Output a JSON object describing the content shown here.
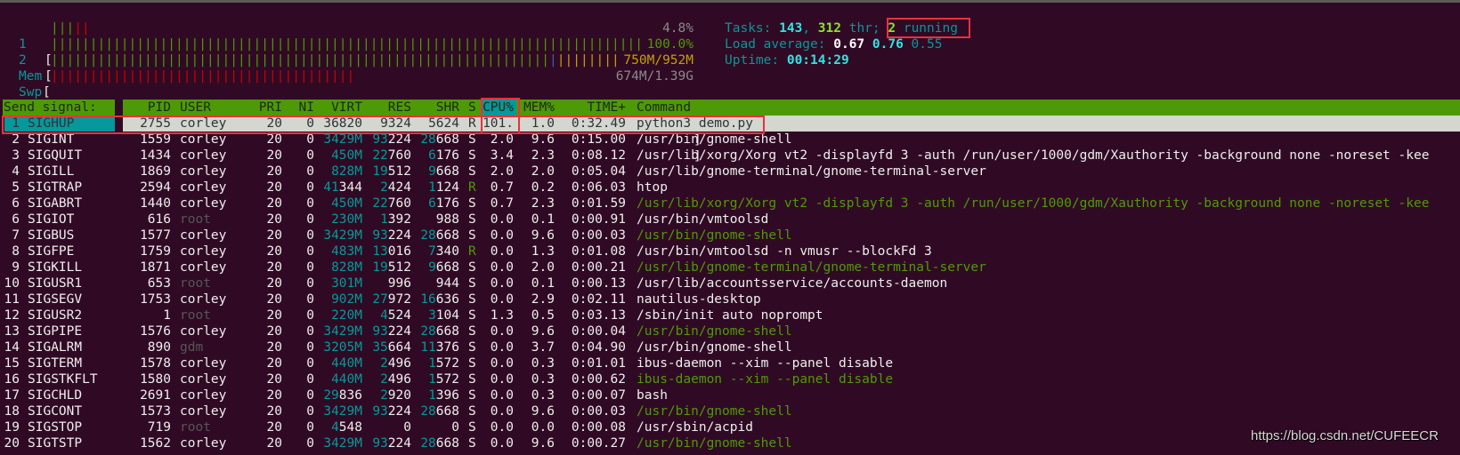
{
  "colors": {
    "background": "#300a24",
    "header_bar": "#4e9a06",
    "selection_signal": "#06989a",
    "selection_row": "#d3d7cf",
    "accent_teal": "#06989a",
    "thread_green": "#4e9a06",
    "dim_user": "#555753",
    "annotation_red": "#e8323c"
  },
  "meters": [
    {
      "label": "1",
      "value": "4.8%",
      "segments": [
        {
          "color": "#4e9a06",
          "percent": 3.7
        },
        {
          "color": "#cc0000",
          "percent": 2.4
        }
      ]
    },
    {
      "label": "2",
      "value": "100.0%",
      "segments": [
        {
          "color": "#4e9a06",
          "percent": 98.8
        },
        {
          "color": "#cc0000",
          "percent": 1.2
        }
      ]
    },
    {
      "label": "Mem",
      "value": "750M/952M",
      "segments": [
        {
          "color": "#4e9a06",
          "percent": 78
        },
        {
          "color": "#3465a4",
          "percent": 1.2
        },
        {
          "color": "#c4a000",
          "percent": 14.6
        }
      ]
    },
    {
      "label": "Swp",
      "value": "674M/1.39G",
      "segments": [
        {
          "color": "#cc0000",
          "percent": 47.6
        }
      ]
    }
  ],
  "info": {
    "tasks_label": "Tasks: ",
    "tasks": "143",
    "sep": ", ",
    "threads": "312",
    "thr_label": " thr; ",
    "running": "2",
    "running_label": " running",
    "load_label": "Load average: ",
    "load1": "0.67",
    "load5": "0.76",
    "load15": "0.55",
    "uptime_label": "Uptime: ",
    "uptime": "00:14:29"
  },
  "signal_panel": {
    "title": "Send signal:",
    "selected_index": 0
  },
  "columns": {
    "pid": "PID",
    "user": "USER",
    "pri": "PRI",
    "ni": "NI",
    "virt": "VIRT",
    "res": "RES",
    "shr": "SHR",
    "s": "S",
    "cpu": "CPU%",
    "mem": "MEM%",
    "time": "TIME+",
    "command": "Command",
    "sorted_by": "cpu"
  },
  "signals": [
    {
      "num": "1",
      "name": "SIGHUP"
    },
    {
      "num": "2",
      "name": "SIGINT"
    },
    {
      "num": "3",
      "name": "SIGQUIT"
    },
    {
      "num": "4",
      "name": "SIGILL"
    },
    {
      "num": "5",
      "name": "SIGTRAP"
    },
    {
      "num": "6",
      "name": "SIGABRT"
    },
    {
      "num": "6",
      "name": "SIGIOT"
    },
    {
      "num": "7",
      "name": "SIGBUS"
    },
    {
      "num": "8",
      "name": "SIGFPE"
    },
    {
      "num": "9",
      "name": "SIGKILL"
    },
    {
      "num": "10",
      "name": "SIGUSR1"
    },
    {
      "num": "11",
      "name": "SIGSEGV"
    },
    {
      "num": "12",
      "name": "SIGUSR2"
    },
    {
      "num": "13",
      "name": "SIGPIPE"
    },
    {
      "num": "14",
      "name": "SIGALRM"
    },
    {
      "num": "15",
      "name": "SIGTERM"
    },
    {
      "num": "16",
      "name": "SIGSTKFLT"
    },
    {
      "num": "17",
      "name": "SIGCHLD"
    },
    {
      "num": "18",
      "name": "SIGCONT"
    },
    {
      "num": "19",
      "name": "SIGSTOP"
    },
    {
      "num": "20",
      "name": "SIGTSTP"
    }
  ],
  "processes": [
    {
      "pid": "2755",
      "user": "corley",
      "pri": "20",
      "ni": "0",
      "virt": "36820",
      "res": "9324",
      "shr": "5624",
      "s": "R",
      "cpu": "101.",
      "mem": "1.0",
      "time": "0:32.49",
      "command": "python3 demo.py",
      "thread": false
    },
    {
      "pid": "1559",
      "user": "corley",
      "pri": "20",
      "ni": "0",
      "virt": "3429M",
      "res": "93224",
      "shr": "28668",
      "s": "S",
      "cpu": "2.0",
      "mem": "9.6",
      "time": "0:15.00",
      "command": "/usr/bin/gnome-shell",
      "thread": false
    },
    {
      "pid": "1434",
      "user": "corley",
      "pri": "20",
      "ni": "0",
      "virt": "450M",
      "res": "22760",
      "shr": "6176",
      "s": "S",
      "cpu": "3.4",
      "mem": "2.3",
      "time": "0:08.12",
      "command": "/usr/lib/xorg/Xorg vt2 -displayfd 3 -auth /run/user/1000/gdm/Xauthority -background none -noreset -kee",
      "thread": false
    },
    {
      "pid": "1869",
      "user": "corley",
      "pri": "20",
      "ni": "0",
      "virt": "828M",
      "res": "19512",
      "shr": "9668",
      "s": "S",
      "cpu": "2.0",
      "mem": "2.0",
      "time": "0:05.04",
      "command": "/usr/lib/gnome-terminal/gnome-terminal-server",
      "thread": false
    },
    {
      "pid": "2594",
      "user": "corley",
      "pri": "20",
      "ni": "0",
      "virt": "41344",
      "res": "2424",
      "shr": "1124",
      "s": "R",
      "cpu": "0.7",
      "mem": "0.2",
      "time": "0:06.03",
      "command": "htop",
      "thread": false
    },
    {
      "pid": "1440",
      "user": "corley",
      "pri": "20",
      "ni": "0",
      "virt": "450M",
      "res": "22760",
      "shr": "6176",
      "s": "S",
      "cpu": "0.7",
      "mem": "2.3",
      "time": "0:01.59",
      "command": "/usr/lib/xorg/Xorg vt2 -displayfd 3 -auth /run/user/1000/gdm/Xauthority -background none -noreset -kee",
      "thread": true
    },
    {
      "pid": "616",
      "user": "root",
      "pri": "20",
      "ni": "0",
      "virt": "230M",
      "res": "1392",
      "shr": "988",
      "s": "S",
      "cpu": "0.0",
      "mem": "0.1",
      "time": "0:00.91",
      "command": "/usr/bin/vmtoolsd",
      "thread": false
    },
    {
      "pid": "1577",
      "user": "corley",
      "pri": "20",
      "ni": "0",
      "virt": "3429M",
      "res": "93224",
      "shr": "28668",
      "s": "S",
      "cpu": "0.0",
      "mem": "9.6",
      "time": "0:00.03",
      "command": "/usr/bin/gnome-shell",
      "thread": true
    },
    {
      "pid": "1759",
      "user": "corley",
      "pri": "20",
      "ni": "0",
      "virt": "483M",
      "res": "13016",
      "shr": "7340",
      "s": "R",
      "cpu": "0.0",
      "mem": "1.3",
      "time": "0:01.08",
      "command": "/usr/bin/vmtoolsd -n vmusr --blockFd 3",
      "thread": false
    },
    {
      "pid": "1871",
      "user": "corley",
      "pri": "20",
      "ni": "0",
      "virt": "828M",
      "res": "19512",
      "shr": "9668",
      "s": "S",
      "cpu": "0.0",
      "mem": "2.0",
      "time": "0:00.21",
      "command": "/usr/lib/gnome-terminal/gnome-terminal-server",
      "thread": true
    },
    {
      "pid": "653",
      "user": "root",
      "pri": "20",
      "ni": "0",
      "virt": "301M",
      "res": "996",
      "shr": "944",
      "s": "S",
      "cpu": "0.0",
      "mem": "0.1",
      "time": "0:00.13",
      "command": "/usr/lib/accountsservice/accounts-daemon",
      "thread": false
    },
    {
      "pid": "1753",
      "user": "corley",
      "pri": "20",
      "ni": "0",
      "virt": "902M",
      "res": "27972",
      "shr": "16636",
      "s": "S",
      "cpu": "0.0",
      "mem": "2.9",
      "time": "0:02.11",
      "command": "nautilus-desktop",
      "thread": false
    },
    {
      "pid": "1",
      "user": "root",
      "pri": "20",
      "ni": "0",
      "virt": "220M",
      "res": "4524",
      "shr": "3104",
      "s": "S",
      "cpu": "1.3",
      "mem": "0.5",
      "time": "0:03.13",
      "command": "/sbin/init auto noprompt",
      "thread": false
    },
    {
      "pid": "1576",
      "user": "corley",
      "pri": "20",
      "ni": "0",
      "virt": "3429M",
      "res": "93224",
      "shr": "28668",
      "s": "S",
      "cpu": "0.0",
      "mem": "9.6",
      "time": "0:00.04",
      "command": "/usr/bin/gnome-shell",
      "thread": true
    },
    {
      "pid": "890",
      "user": "gdm",
      "pri": "20",
      "ni": "0",
      "virt": "3205M",
      "res": "35664",
      "shr": "11376",
      "s": "S",
      "cpu": "0.0",
      "mem": "3.7",
      "time": "0:04.90",
      "command": "/usr/bin/gnome-shell",
      "thread": false
    },
    {
      "pid": "1578",
      "user": "corley",
      "pri": "20",
      "ni": "0",
      "virt": "440M",
      "res": "2496",
      "shr": "1572",
      "s": "S",
      "cpu": "0.0",
      "mem": "0.3",
      "time": "0:01.01",
      "command": "ibus-daemon --xim --panel disable",
      "thread": false
    },
    {
      "pid": "1580",
      "user": "corley",
      "pri": "20",
      "ni": "0",
      "virt": "440M",
      "res": "2496",
      "shr": "1572",
      "s": "S",
      "cpu": "0.0",
      "mem": "0.3",
      "time": "0:00.62",
      "command": "ibus-daemon --xim --panel disable",
      "thread": true
    },
    {
      "pid": "2691",
      "user": "corley",
      "pri": "20",
      "ni": "0",
      "virt": "29836",
      "res": "2920",
      "shr": "1396",
      "s": "S",
      "cpu": "0.0",
      "mem": "0.3",
      "time": "0:00.07",
      "command": "bash",
      "thread": false
    },
    {
      "pid": "1573",
      "user": "corley",
      "pri": "20",
      "ni": "0",
      "virt": "3429M",
      "res": "93224",
      "shr": "28668",
      "s": "S",
      "cpu": "0.0",
      "mem": "9.6",
      "time": "0:00.03",
      "command": "/usr/bin/gnome-shell",
      "thread": true
    },
    {
      "pid": "719",
      "user": "root",
      "pri": "20",
      "ni": "0",
      "virt": "4548",
      "res": "0",
      "shr": "0",
      "s": "S",
      "cpu": "0.0",
      "mem": "0.0",
      "time": "0:00.08",
      "command": "/usr/sbin/acpid",
      "thread": false
    },
    {
      "pid": "1562",
      "user": "corley",
      "pri": "20",
      "ni": "0",
      "virt": "3429M",
      "res": "93224",
      "shr": "28668",
      "s": "S",
      "cpu": "0.0",
      "mem": "9.6",
      "time": "0:00.27",
      "command": "/usr/bin/gnome-shell",
      "thread": true
    }
  ],
  "watermark": "https://blog.csdn.net/CUFEECR"
}
